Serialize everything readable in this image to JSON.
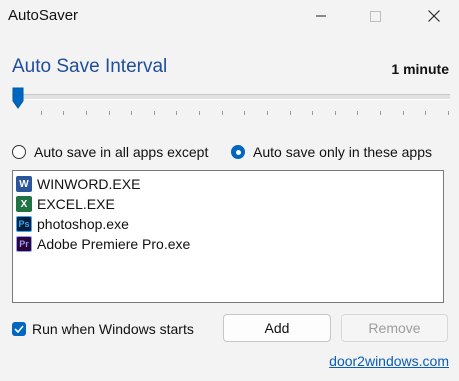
{
  "window": {
    "title": "AutoSaver"
  },
  "interval": {
    "label": "Auto Save Interval",
    "value_text": "1 minute",
    "slider_level": 0,
    "tick_count": 20
  },
  "mode": {
    "options": [
      {
        "label": "Auto save in all apps except",
        "selected": false
      },
      {
        "label": "Auto save only in these apps",
        "selected": true
      }
    ]
  },
  "apps": [
    {
      "name": "WINWORD.EXE",
      "icon": "word-icon",
      "glyph": "W"
    },
    {
      "name": "EXCEL.EXE",
      "icon": "excel-icon",
      "glyph": "X"
    },
    {
      "name": "photoshop.exe",
      "icon": "photoshop-icon",
      "glyph": "Ps"
    },
    {
      "name": "Adobe Premiere Pro.exe",
      "icon": "premiere-icon",
      "glyph": "Pr"
    }
  ],
  "startup": {
    "label": "Run when Windows starts",
    "checked": true
  },
  "buttons": {
    "add": "Add",
    "remove": "Remove"
  },
  "footer": {
    "link": "door2windows.com"
  },
  "colors": {
    "accent": "#0067c0",
    "heading": "#1f4e9c",
    "link": "#0a5db8"
  }
}
